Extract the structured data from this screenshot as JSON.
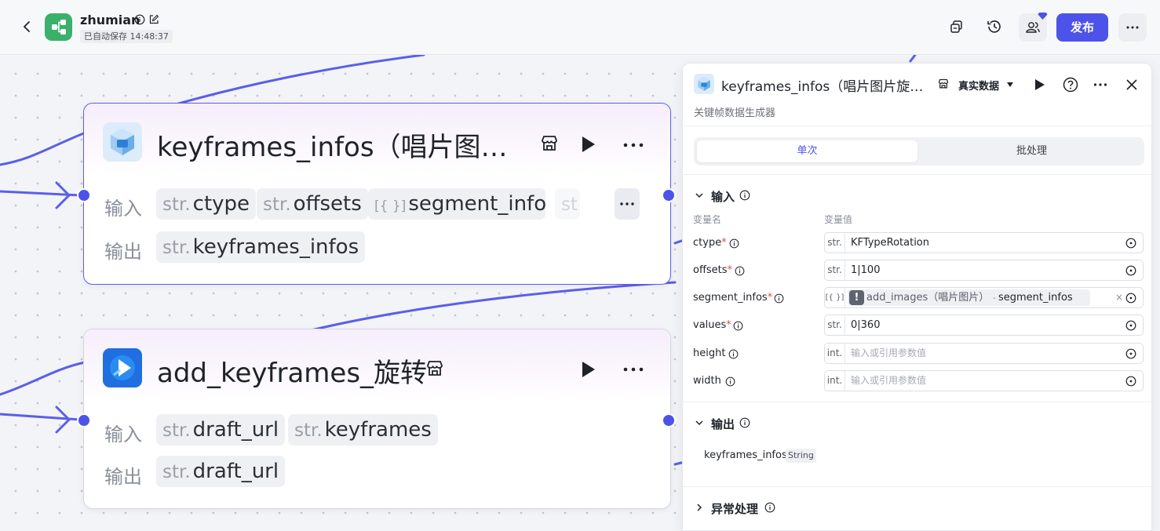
{
  "header": {
    "app_name": "zhumian",
    "autosave": "已自动保存 14:48:37",
    "publish_label": "发布",
    "colors": {
      "accent": "#4d53e8",
      "logo": "#3ab06a"
    }
  },
  "canvas": {
    "nodes": [
      {
        "title": "keyframes_infos（唱片图片旋转）",
        "input_label": "输入",
        "output_label": "输出",
        "inputs": [
          {
            "type": "str.",
            "name": "ctype"
          },
          {
            "type": "str.",
            "name": "offsets"
          },
          {
            "type": "[{ }]",
            "name": "segment_infos"
          },
          {
            "type": "st",
            "name": ""
          }
        ],
        "outputs": [
          {
            "type": "str.",
            "name": "keyframes_infos"
          }
        ]
      },
      {
        "title": "add_keyframes_旋转",
        "input_label": "输入",
        "output_label": "输出",
        "inputs": [
          {
            "type": "str.",
            "name": "draft_url"
          },
          {
            "type": "str.",
            "name": "keyframes"
          }
        ],
        "outputs": [
          {
            "type": "str.",
            "name": "draft_url"
          }
        ]
      }
    ]
  },
  "panel": {
    "title": "keyframes_infos（唱片图片旋转）",
    "data_mode": "真实数据",
    "subtitle": "关键帧数据生成器",
    "tabs": {
      "single": "单次",
      "batch": "批处理"
    },
    "input_section": "输入",
    "col_name": "变量名",
    "col_value": "变量值",
    "fields": [
      {
        "label": "ctype",
        "required": "*",
        "type": "str.",
        "value": "KFTypeRotation",
        "placeholder": ""
      },
      {
        "label": "offsets",
        "required": "*",
        "type": "str.",
        "value": "1|100",
        "placeholder": ""
      },
      {
        "label": "segment_infos",
        "required": "*",
        "type": "[{ }]",
        "value": "",
        "placeholder": ""
      },
      {
        "label": "values",
        "required": "*",
        "type": "str.",
        "value": "0|360",
        "placeholder": ""
      },
      {
        "label": "height",
        "required": "",
        "type": "int.",
        "value": "",
        "placeholder": "输入或引用参数值"
      },
      {
        "label": "width",
        "required": "",
        "type": "int.",
        "value": "",
        "placeholder": "输入或引用参数值"
      }
    ],
    "ref": {
      "warn": "!",
      "source": "add_images（唱片图片）",
      "sep": "-",
      "field": "segment_infos",
      "close": "×"
    },
    "output_section": "输出",
    "output": {
      "name": "keyframes_infos",
      "type": "String"
    },
    "error_section": "异常处理"
  }
}
